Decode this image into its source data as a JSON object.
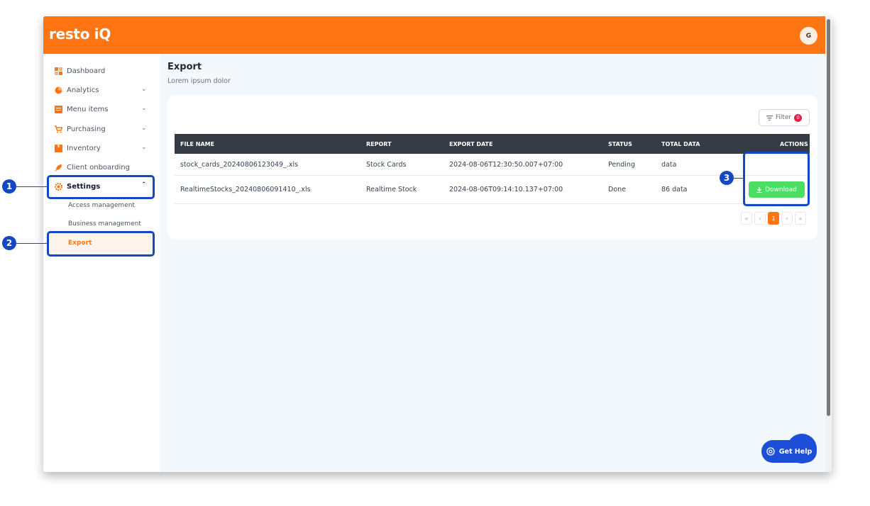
{
  "header": {
    "logo": "resto iQ",
    "avatar_initial": "G"
  },
  "sidebar": {
    "items": [
      {
        "label": "Dashboard",
        "icon": "dashboard-grid-icon"
      },
      {
        "label": "Analytics",
        "icon": "pie-chart-icon"
      },
      {
        "label": "Menu items",
        "icon": "menu-book-icon"
      },
      {
        "label": "Purchasing",
        "icon": "shopping-cart-icon"
      },
      {
        "label": "Inventory",
        "icon": "box-icon"
      },
      {
        "label": "Client onboarding",
        "icon": "rocket-icon"
      },
      {
        "label": "Settings",
        "icon": "gear-icon"
      }
    ],
    "settings_sub": [
      "Access management",
      "Business management",
      "Export"
    ]
  },
  "main": {
    "title": "Export",
    "subtitle": "Lorem ipsum dolor",
    "filter": {
      "label": "Filter",
      "count": "0"
    },
    "table": {
      "columns": [
        "FILE NAME",
        "REPORT",
        "EXPORT DATE",
        "STATUS",
        "TOTAL DATA",
        "ACTIONS"
      ],
      "rows": [
        {
          "file": "stock_cards_20240806123049_.xls",
          "report": "Stock Cards",
          "date": "2024-08-06T12:30:50.007+07:00",
          "status": "Pending",
          "total": "data",
          "action": ""
        },
        {
          "file": "RealtimeStocks_20240806091410_.xls",
          "report": "Realtime Stock",
          "date": "2024-08-06T09:14:10.137+07:00",
          "status": "Done",
          "total": "86 data",
          "action": "Download"
        }
      ]
    },
    "pagination": {
      "first": "«",
      "prev": "‹",
      "current": "1",
      "next": "›",
      "last": "»"
    }
  },
  "help": {
    "label": "Get Help"
  },
  "callouts": [
    "1",
    "2",
    "3"
  ],
  "colors": {
    "brand": "#ff7514",
    "annotation": "#1448c2",
    "download": "#4ade62"
  }
}
